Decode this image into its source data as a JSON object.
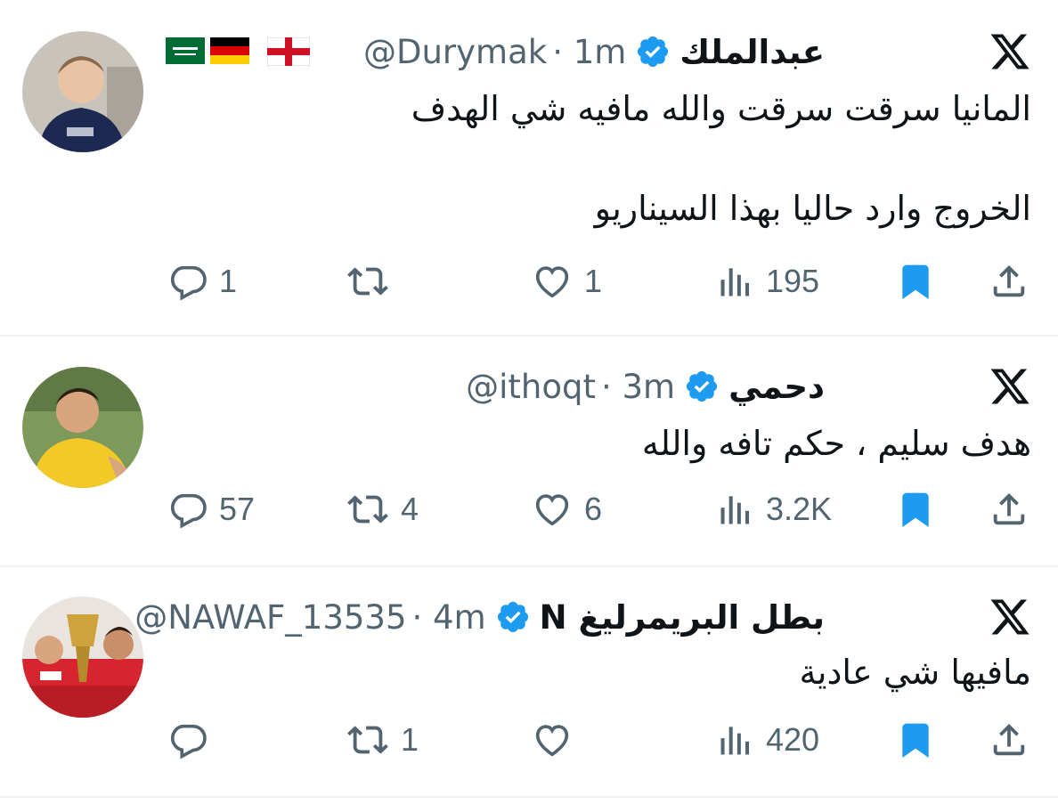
{
  "colors": {
    "verified": "#1d9bf0",
    "bookmark": "#1d9bf0",
    "muted": "#536471",
    "text": "#0f1419",
    "separator": "#eef0f2"
  },
  "icons": {
    "platform": "x-logo-icon",
    "reply": "reply-icon",
    "retweet": "retweet-icon",
    "like": "heart-icon",
    "views": "views-icon",
    "bookmark": "bookmark-filled-icon",
    "share": "share-icon"
  },
  "tweets": [
    {
      "author": "عبدالملك",
      "flags": [
        "saudi-flag-icon",
        "germany-flag-icon",
        "england-flag-icon"
      ],
      "handle": "@Durymak",
      "time": "· 1m",
      "text_lines": [
        "المانيا سرقت سرقت والله مافيه شي الهدف",
        "الخروج وارد حاليا بهذا السيناريو"
      ],
      "replies": "1",
      "retweets": "",
      "likes": "1",
      "views": "195",
      "bookmarked": true
    },
    {
      "author": "دحمي",
      "handle": "@ithoqt",
      "time": "· 3m",
      "text_lines": [
        "هدف سليم ، حكم تافه والله"
      ],
      "replies": "57",
      "retweets": "4",
      "likes": "6",
      "views": "3.2K",
      "bookmarked": true
    },
    {
      "author": "بطل البريمرليغ N",
      "handle": "@NAWAF_13535",
      "time": "· 4m",
      "text_lines": [
        "مافيها شي عادية"
      ],
      "replies": "",
      "retweets": "1",
      "likes": "",
      "views": "420",
      "bookmarked": true
    }
  ]
}
